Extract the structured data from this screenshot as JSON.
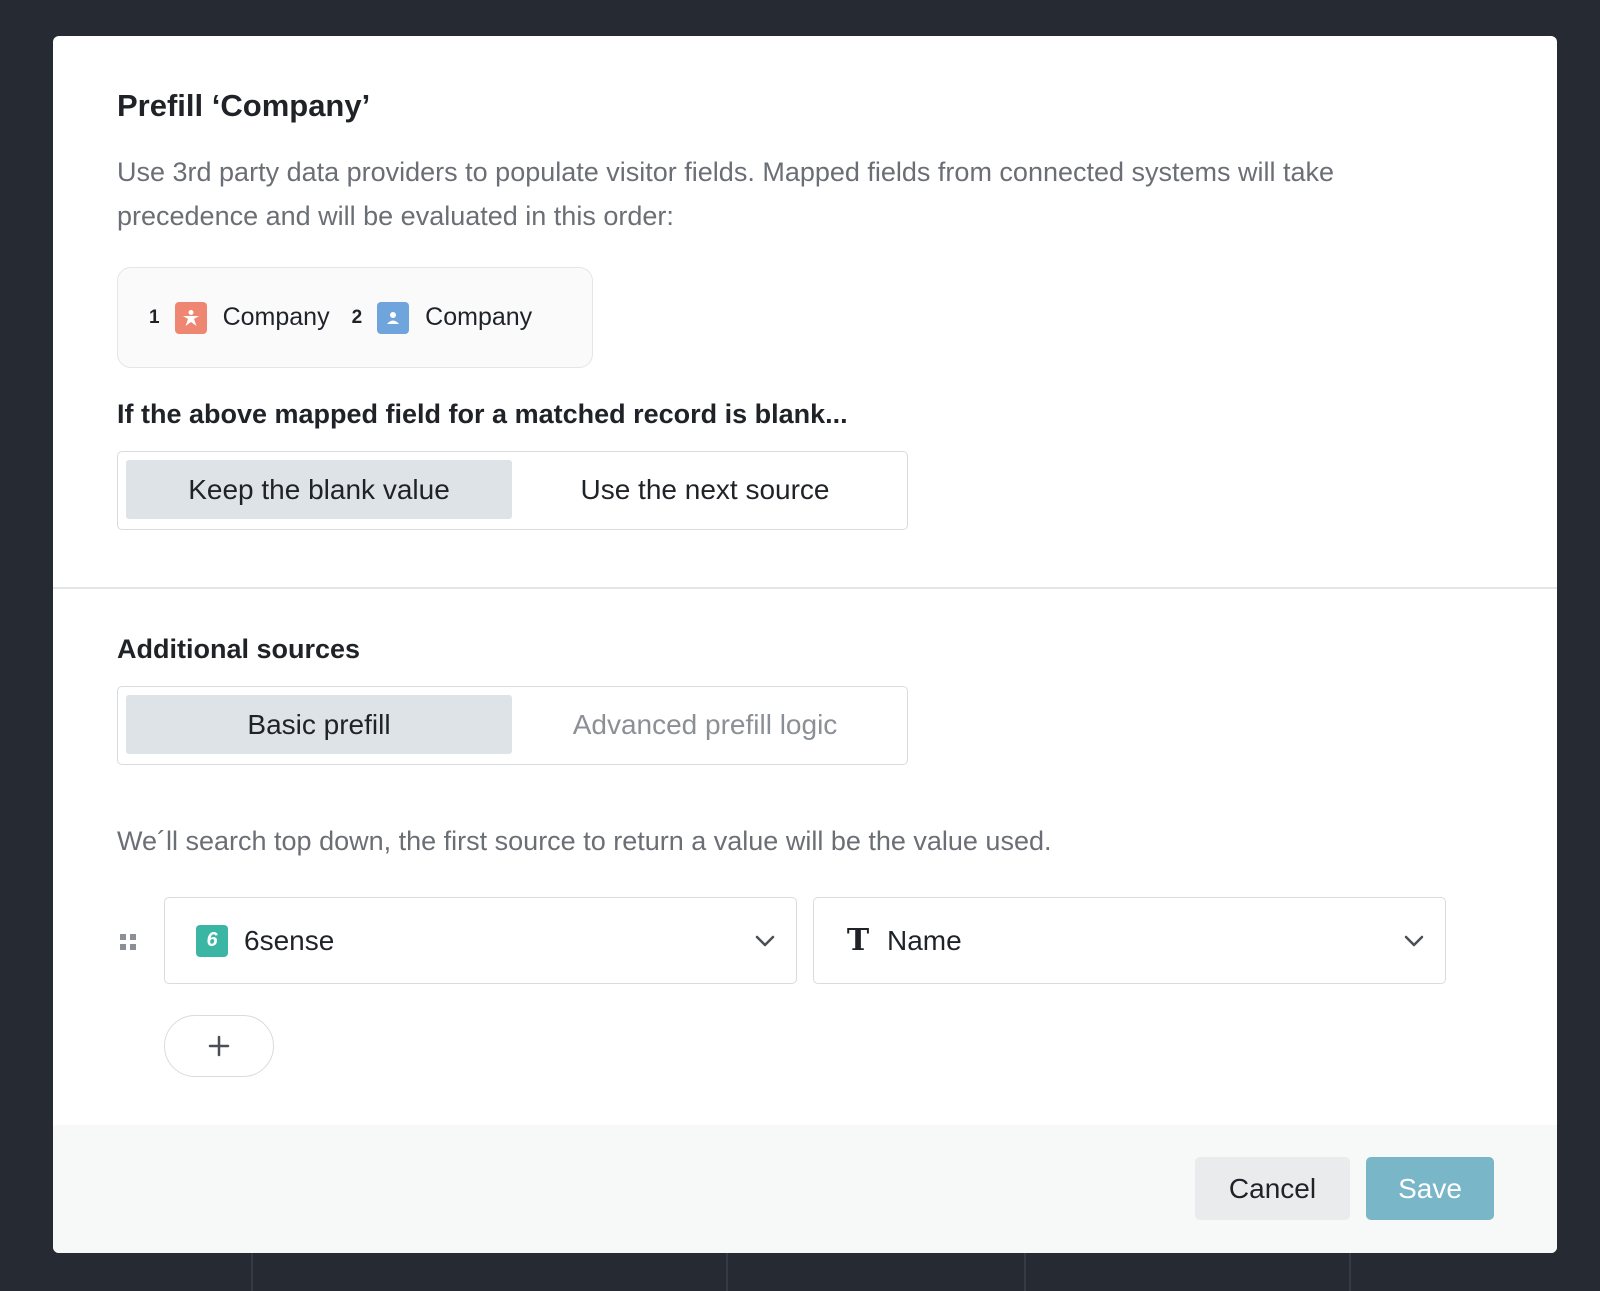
{
  "dialog": {
    "title": "Prefill ‘Company’",
    "description": "Use 3rd party data providers to populate visitor fields. Mapped fields from connected systems will take precedence and will be evaluated in this order:",
    "order": [
      {
        "num": "1",
        "icon": "salesforce-person-icon",
        "color": "#ef8671",
        "label": "Company"
      },
      {
        "num": "2",
        "icon": "user-icon",
        "color": "#6fa4dc",
        "label": "Company"
      }
    ],
    "blank_question": "If the above mapped field for a matched record is blank...",
    "blank_options": {
      "keep": "Keep the blank value",
      "next": "Use the next source",
      "selected": "keep"
    }
  },
  "additional": {
    "heading": "Additional sources",
    "modes": {
      "basic": "Basic prefill",
      "advanced": "Advanced prefill logic",
      "selected": "basic"
    },
    "hint": "We´ll search top down, the first source to return a value will be the value used.",
    "sources": [
      {
        "provider": "6sense",
        "provider_icon_glyph": "6",
        "provider_color": "#3bb6a4",
        "field": "Name",
        "field_icon": "text-type-icon"
      }
    ],
    "add_symbol": "+"
  },
  "footer": {
    "cancel": "Cancel",
    "save": "Save",
    "save_color": "#78b6c8"
  }
}
